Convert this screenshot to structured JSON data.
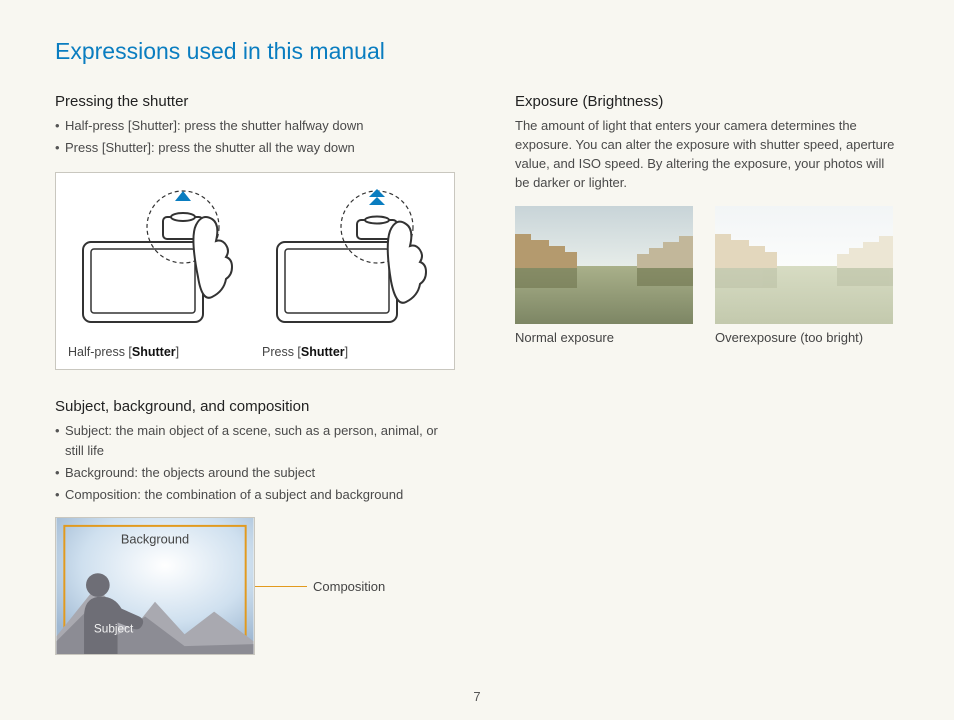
{
  "title": "Expressions used in this manual",
  "pageNumber": "7",
  "left": {
    "pressing": {
      "heading": "Pressing the shutter",
      "bullets": {
        "0": {
          "pre": "Half-press [",
          "bold": "Shutter",
          "post": "]: press the shutter halfway down"
        },
        "1": {
          "pre": "Press [",
          "bold": "Shutter",
          "post": "]: press the shutter all the way down"
        }
      },
      "captions": {
        "half": {
          "pre": "Half-press [",
          "bold": "Shutter",
          "post": "]"
        },
        "full": {
          "pre": "Press [",
          "bold": "Shutter",
          "post": "]"
        }
      }
    },
    "sbc": {
      "heading": "Subject, background, and composition",
      "bullets": {
        "0": {
          "bold": "Subject",
          "post": ": the main object of a scene, such as a person, animal, or still life"
        },
        "1": {
          "bold": "Background",
          "post": ": the objects around the subject"
        },
        "2": {
          "bold": "Composition",
          "post": ": the combination of a subject and background"
        }
      },
      "figLabels": {
        "subject": "Subject",
        "background": "Background",
        "composition": "Composition"
      }
    }
  },
  "right": {
    "exposure": {
      "heading": "Exposure (Brightness)",
      "body": "The amount of light that enters your camera determines the exposure. You can alter the exposure with shutter speed, aperture value, and ISO speed. By altering the exposure, your photos will be darker or lighter.",
      "photoCaps": {
        "normal": "Normal exposure",
        "over": "Overexposure (too bright)"
      }
    }
  }
}
